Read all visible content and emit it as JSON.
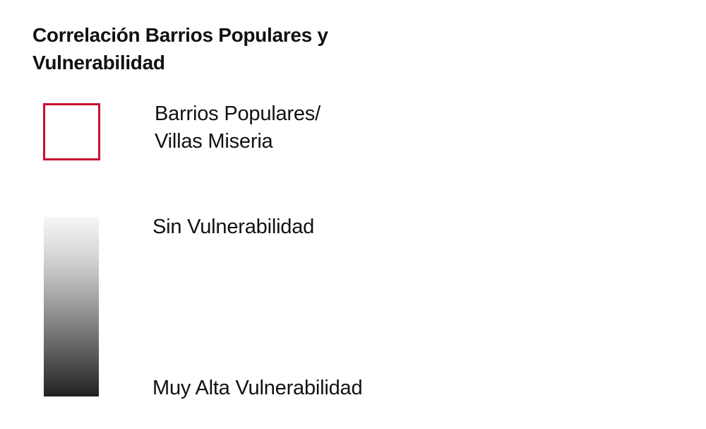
{
  "legend": {
    "title_lines": [
      "Correlación Barrios Populares y",
      "Vulnerabilidad"
    ],
    "outline_item": {
      "color": "#c8102e",
      "label_lines": [
        "Barrios Populares/",
        "Villas Miseria"
      ]
    },
    "gradient": {
      "top_color": "#f7f7f7",
      "bottom_color": "#222222",
      "top_label": "Sin Vulnerabilidad",
      "bottom_label": "Muy Alta Vulnerabilidad"
    }
  }
}
